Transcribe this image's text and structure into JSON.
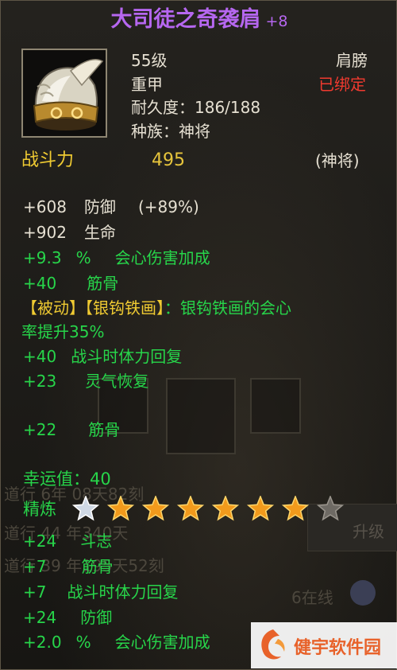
{
  "item": {
    "name": "大司徒之奇袭肩",
    "enhance": "+8",
    "level": "55级",
    "slot": "肩膀",
    "armor_type": "重甲",
    "bound_status": "已绑定",
    "durability_label": "耐久度：",
    "durability": "186/188",
    "race_label": "种族：",
    "race": "神将",
    "power_label": "战斗力",
    "power_value": "495",
    "power_class": "(神将)",
    "icon": "winged-helmet-icon"
  },
  "base_stats": [
    {
      "value": "+608",
      "name": "防御",
      "extra": "(+89%)"
    },
    {
      "value": "+902",
      "name": "生命",
      "extra": ""
    }
  ],
  "bonus_stats": [
    {
      "value": "+9.3",
      "unit": "%",
      "name": "会心伤害加成"
    },
    {
      "value": "+40",
      "name": "筋骨"
    }
  ],
  "passive": {
    "line1_tag": "【被动】",
    "line1_skill": "【银钩铁画】",
    "line1_text": "：银钩铁画的会心",
    "line2_text": "率提升35%"
  },
  "extra_stats": [
    {
      "value": "+40",
      "name": "战斗时体力回复"
    },
    {
      "value": "+23",
      "name": "灵气恢复"
    },
    {
      "value": "+22",
      "name": "筋骨"
    }
  ],
  "luck": {
    "label": "幸运值：",
    "value": "40"
  },
  "refine": {
    "label": "精炼",
    "filled": 7,
    "total": 8
  },
  "refine_stats": [
    {
      "value": "+24",
      "name": "斗志"
    },
    {
      "value": "+7",
      "name": "筋骨"
    },
    {
      "value": "+7",
      "name": "战斗时体力回复"
    },
    {
      "value": "+24",
      "name": "防御"
    },
    {
      "value": "+2.0",
      "unit": "%",
      "name": "会心伤害加成"
    }
  ],
  "background": {
    "ghost_lines": [
      "道行 6年 08天82刻",
      "道行 44 年340天",
      "道行 39 年195天52刻",
      "6在线"
    ],
    "ghost_button": "升级"
  },
  "watermark": "健宇软件园",
  "colors": {
    "title": "#b667f0",
    "green": "#27d54a",
    "yellow": "#f0cb32",
    "red": "#f03a2f",
    "white": "#e6e0d2"
  }
}
